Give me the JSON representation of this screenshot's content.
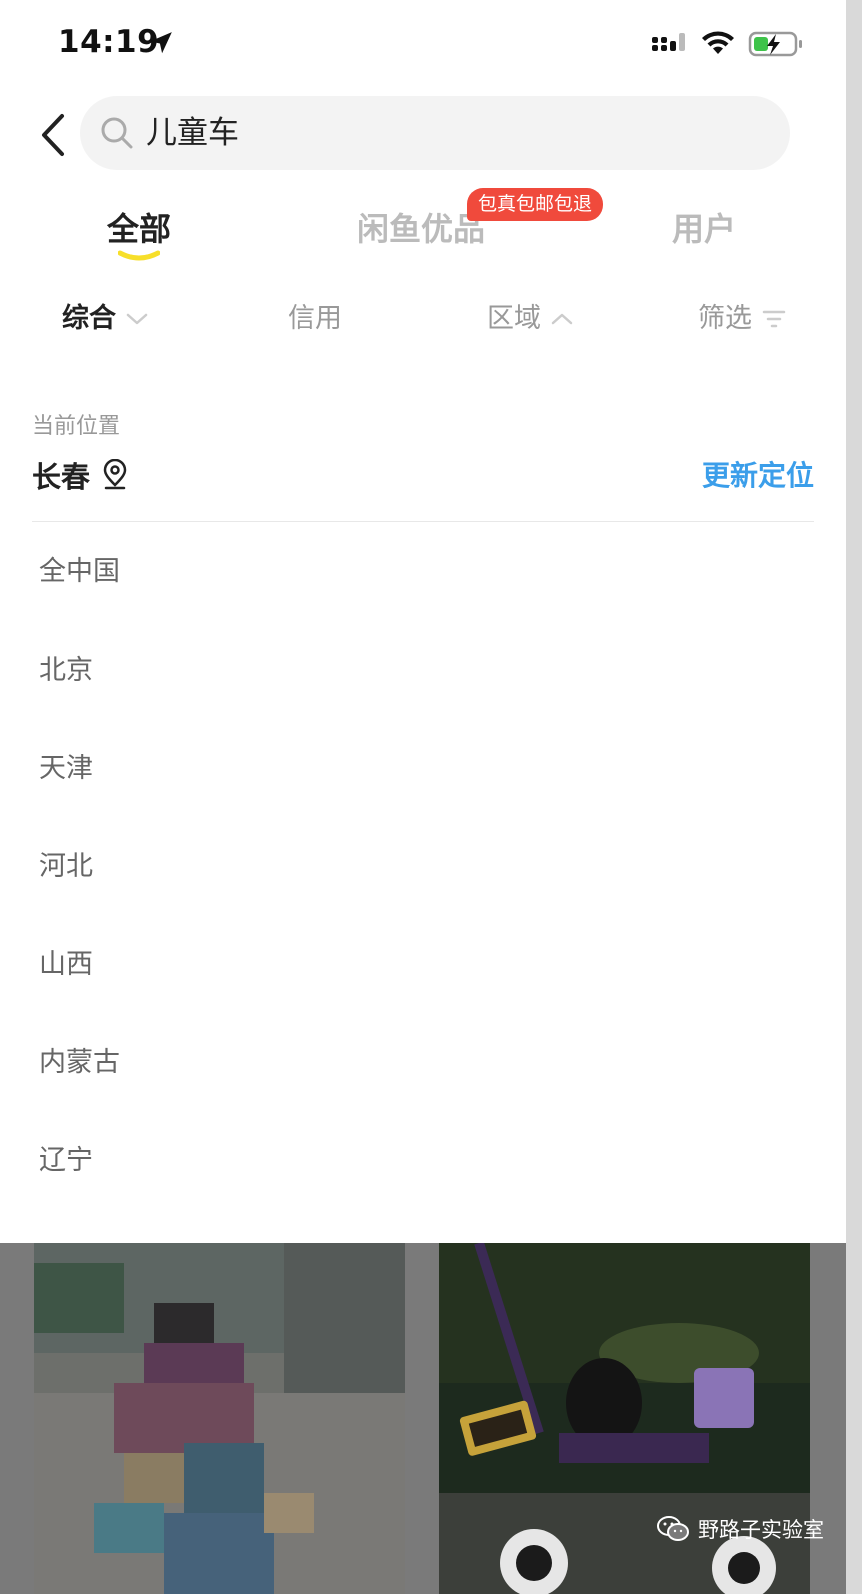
{
  "status_bar": {
    "time": "14:19",
    "icons": [
      "location-arrow-icon",
      "cellular-signal-icon",
      "wifi-icon",
      "battery-charging-icon"
    ]
  },
  "search": {
    "query": "儿童车"
  },
  "tabs": [
    {
      "label": "全部",
      "active": true
    },
    {
      "label": "闲鱼优品",
      "active": false,
      "badge": "包真包邮包退"
    },
    {
      "label": "用户",
      "active": false
    }
  ],
  "sort_bar": {
    "general": "综合",
    "credit": "信用",
    "region": "区域",
    "filter": "筛选"
  },
  "location": {
    "caption": "当前位置",
    "city": "长春",
    "relocate": "更新定位"
  },
  "regions": [
    "全中国",
    "北京",
    "天津",
    "河北",
    "山西",
    "内蒙古",
    "辽宁"
  ],
  "watermark": "野路子实验室",
  "colors": {
    "accent_blue": "#3b9eea",
    "badge_red": "#f04a3c",
    "tab_underline": "#f7df2a"
  }
}
